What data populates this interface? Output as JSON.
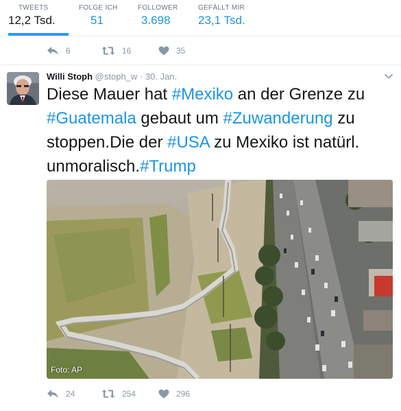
{
  "profile_stats": [
    {
      "label": "TWEETS",
      "value": "12,2 Tsd."
    },
    {
      "label": "FOLGE ICH",
      "value": "51"
    },
    {
      "label": "FOLLOWER",
      "value": "3.698"
    },
    {
      "label": "GEFÄLLT MIR",
      "value": "23,1 Tsd."
    }
  ],
  "previous_tweet_actions": {
    "replies": "6",
    "retweets": "16",
    "likes": "35"
  },
  "tweet": {
    "author_name": "Willi Stoph",
    "handle": "@stoph_w",
    "separator": "·",
    "date": "30. Jan.",
    "text_parts": {
      "p1": "Diese Mauer hat ",
      "h1": "#Mexiko",
      "p2": " an der Grenze zu ",
      "h2": "#Guatemala",
      "p3": " gebaut um ",
      "h3": "#Zuwanderung",
      "p4": " zu stoppen.Die der ",
      "h4": "#USA",
      "p5": " zu Mexiko ist natürl. unmoralisch.",
      "h5": "#Trump"
    },
    "photo_caption": "Foto: AP",
    "actions": {
      "replies": "24",
      "retweets": "254",
      "likes": "296"
    }
  },
  "colors": {
    "accent": "#1da1f2",
    "link": "#1b95e0",
    "muted": "#8899a6"
  },
  "icons": [
    "reply-icon",
    "retweet-icon",
    "heart-icon",
    "chevron-down-icon"
  ]
}
